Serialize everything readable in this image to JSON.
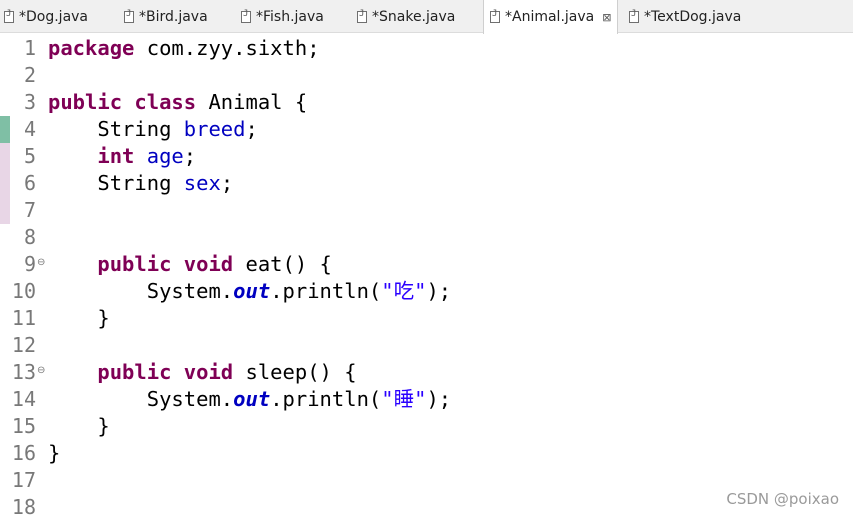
{
  "tabs": [
    {
      "label": "*Dog.java"
    },
    {
      "label": "*Bird.java"
    },
    {
      "label": "*Fish.java"
    },
    {
      "label": "*Snake.java"
    },
    {
      "label": "*Animal.java",
      "active": true
    },
    {
      "label": "*TextDog.java"
    }
  ],
  "close_glyph": "⊠",
  "line_numbers": [
    "1",
    "2",
    "3",
    "4",
    "5",
    "6",
    "7",
    "8",
    "9",
    "10",
    "11",
    "12",
    "13",
    "14",
    "15",
    "16",
    "17",
    "18"
  ],
  "code": {
    "l1_kw": "package",
    "l1_rest": " com.zyy.sixth;",
    "l3_kw1": "public",
    "l3_kw2": "class",
    "l3_rest": " Animal {",
    "l4_type": "String",
    "l4_field": "breed",
    "l4_end": ";",
    "l5_kw": "int",
    "l5_field": "age",
    "l5_end": ";",
    "l6_type": "String",
    "l6_field": "sex",
    "l6_end": ";",
    "l9_kw1": "public",
    "l9_kw2": "void",
    "l9_rest": " eat() {",
    "l10_pre": "System.",
    "l10_out": "out",
    "l10_mid": ".println(",
    "l10_str": "\"吃\"",
    "l10_end": ");",
    "l11": "}",
    "l13_kw1": "public",
    "l13_kw2": "void",
    "l13_rest": " sleep() {",
    "l14_pre": "System.",
    "l14_out": "out",
    "l14_mid": ".println(",
    "l14_str": "\"睡\"",
    "l14_end": ");",
    "l15": "}",
    "l16": "}"
  },
  "fold_glyph": "⊖",
  "watermark": "CSDN @poixao",
  "colors": {
    "keyword": "#7f0055",
    "field": "#0000c0",
    "string": "#2a00ff",
    "change_green": "#7fbfa5",
    "change_pink": "#e8d6e6"
  }
}
